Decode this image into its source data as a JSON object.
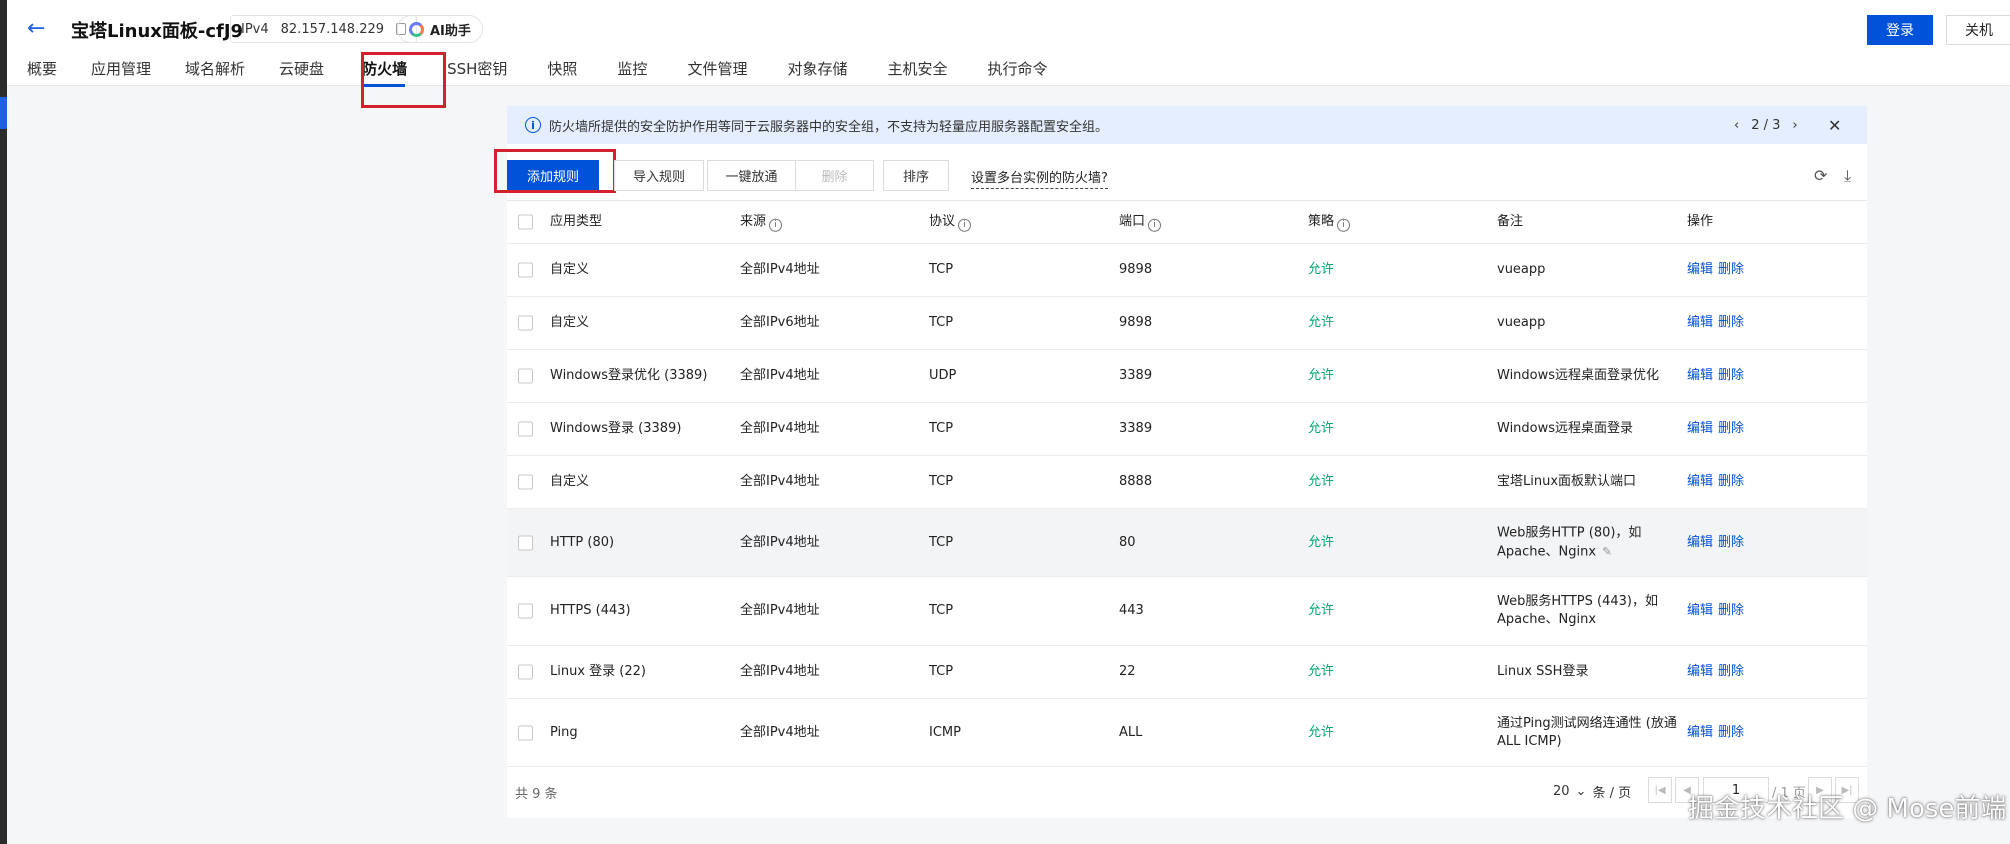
{
  "header": {
    "title": "宝塔Linux面板-cfJ9",
    "ip_type": "IPv4",
    "ip": "82.157.148.229",
    "ai_label": "AI助手",
    "login_label": "登录",
    "shutdown_label": "关机"
  },
  "tabs": [
    "概要",
    "应用管理",
    "域名解析",
    "云硬盘",
    "防火墙",
    "SSH密钥",
    "快照",
    "监控",
    "文件管理",
    "对象存储",
    "主机安全",
    "执行命令"
  ],
  "active_tab": "防火墙",
  "notice": {
    "text": "防火墙所提供的安全防护作用等同于云服务器中的安全组，不支持为轻量应用服务器配置安全组。",
    "pager": "2 / 3"
  },
  "toolbar": {
    "add_rule": "添加规则",
    "import_rules": "导入规则",
    "one_click_allow": "一键放通",
    "delete": "删除",
    "sort": "排序",
    "multi_instance_link": "设置多台实例的防火墙?"
  },
  "table": {
    "columns": [
      "应用类型",
      "来源",
      "协议",
      "端口",
      "策略",
      "备注",
      "操作"
    ],
    "rows": [
      {
        "type": "自定义",
        "source": "全部IPv4地址",
        "protocol": "TCP",
        "port": "9898",
        "policy": "允许",
        "note": "vueapp"
      },
      {
        "type": "自定义",
        "source": "全部IPv6地址",
        "protocol": "TCP",
        "port": "9898",
        "policy": "允许",
        "note": "vueapp"
      },
      {
        "type": "Windows登录优化 (3389)",
        "source": "全部IPv4地址",
        "protocol": "UDP",
        "port": "3389",
        "policy": "允许",
        "note": "Windows远程桌面登录优化"
      },
      {
        "type": "Windows登录 (3389)",
        "source": "全部IPv4地址",
        "protocol": "TCP",
        "port": "3389",
        "policy": "允许",
        "note": "Windows远程桌面登录"
      },
      {
        "type": "自定义",
        "source": "全部IPv4地址",
        "protocol": "TCP",
        "port": "8888",
        "policy": "允许",
        "note": "宝塔Linux面板默认端口"
      },
      {
        "type": "HTTP (80)",
        "source": "全部IPv4地址",
        "protocol": "TCP",
        "port": "80",
        "policy": "允许",
        "note": "Web服务HTTP (80)，如",
        "note2": "Apache、Nginx"
      },
      {
        "type": "HTTPS (443)",
        "source": "全部IPv4地址",
        "protocol": "TCP",
        "port": "443",
        "policy": "允许",
        "note": "Web服务HTTPS (443)，如",
        "note2": "Apache、Nginx"
      },
      {
        "type": "Linux 登录 (22)",
        "source": "全部IPv4地址",
        "protocol": "TCP",
        "port": "22",
        "policy": "允许",
        "note": "Linux SSH登录"
      },
      {
        "type": "Ping",
        "source": "全部IPv4地址",
        "protocol": "ICMP",
        "port": "ALL",
        "policy": "允许",
        "note": "通过Ping测试网络连通性 (放通",
        "note2": "ALL ICMP)"
      }
    ],
    "edit_label": "编辑",
    "delete_label": "删除"
  },
  "footer": {
    "total": "共 9 条",
    "page_size": "20",
    "per_page": "条 / 页",
    "current_page": "1",
    "total_pages": "/ 1 页"
  },
  "watermark": "掘金技术社区 @ Mose前端",
  "colors": {
    "primary": "#0052d9",
    "allow": "#00a870",
    "highlight": "#d4212e",
    "notice_bg": "#e5eefe"
  }
}
